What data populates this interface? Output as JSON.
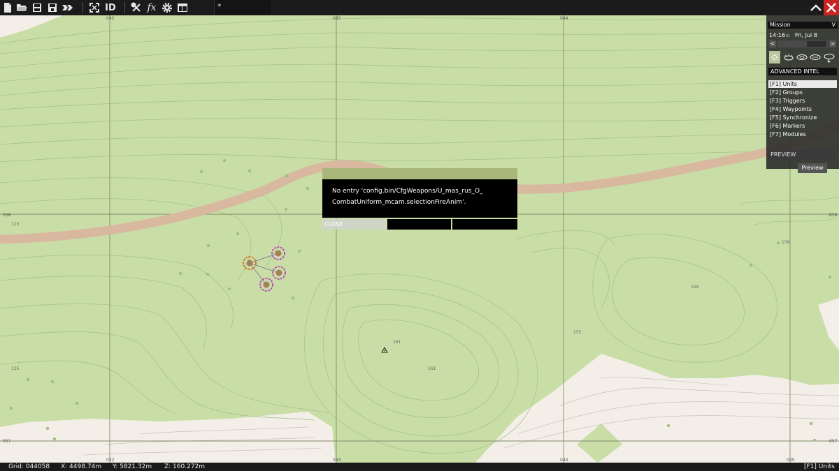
{
  "toolbar": {
    "icons": [
      "new-file-icon",
      "open-folder-icon",
      "save-icon",
      "save-as-icon",
      "export-icon",
      "center-view-icon",
      "id-toggle-icon",
      "tools-icon",
      "functions-icon",
      "settings-icon",
      "layout-icon"
    ],
    "id_label": "ID",
    "fx_label": "fx",
    "tab_label": "*",
    "minimize_glyph": "∧",
    "close_glyph": "✕"
  },
  "map": {
    "grid_top_labels": [
      "042",
      "043",
      "044"
    ],
    "grid_bottom_labels": [
      "042",
      "043",
      "044",
      "045"
    ],
    "grid_left_labels": [
      "058",
      "057"
    ],
    "grid_right_labels": [
      "058",
      "057"
    ],
    "elevations": [
      "123",
      "135",
      "161",
      "161",
      "155",
      "158",
      "159"
    ]
  },
  "side_panel": {
    "mission_label": "Mission",
    "mission_toggle": "V",
    "time": "14:16",
    "time_suffix": "01",
    "date": "Fri, Jul 8",
    "prev": "<",
    "next": ">",
    "advanced_intel": "ADVANCED INTEL",
    "modes": [
      "[F1] Units",
      "[F2] Groups",
      "[F3] Triggers",
      "[F4] Waypoints",
      "[F5] Synchronize",
      "[F6] Markers",
      "[F7] Modules"
    ],
    "preview_header": "PREVIEW",
    "preview_button": "Preview"
  },
  "dialog": {
    "line1": "No entry 'config.bin/CfgWeapons/U_mas_rus_O_",
    "line2": "CombatUniform_mcam.selectionFireAnim'.",
    "close": "CLOSE",
    "accent": "#a9b87a"
  },
  "status": {
    "grid": "Grid: 044058",
    "x": "X: 4498.74m",
    "y": "Y: 5821.32m",
    "z": "Z: 160.272m",
    "mode": "[F1] Units"
  },
  "colors": {
    "map_green": "#c9dea6",
    "contour": "#a3bf84",
    "road": "#d8b9a0",
    "open_ground": "#f3efe8",
    "grid_line": "#7f8a6a"
  }
}
